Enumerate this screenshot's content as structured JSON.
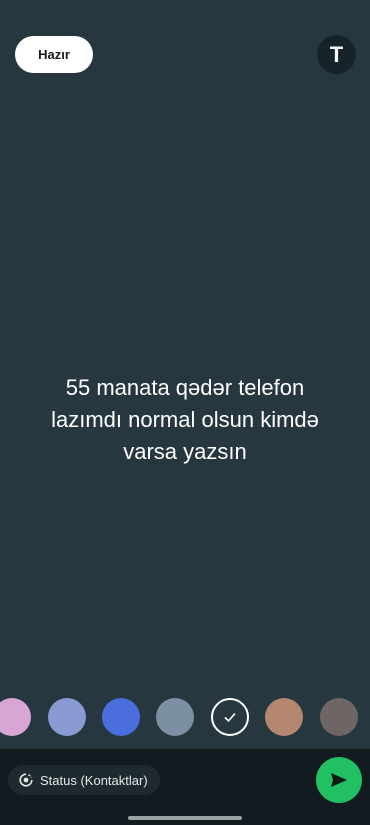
{
  "header": {
    "done_label": "Hazır",
    "text_tool_glyph": "T"
  },
  "status": {
    "text": "55 manata qədər telefon lazımdı normal olsun kimdə varsa yazsın"
  },
  "palette": {
    "colors": [
      "#d7a6d4",
      "#8a9bd4",
      "#4a6fdc",
      "#7d8fa3",
      "selected",
      "#b58670",
      "#6e6565"
    ]
  },
  "footer": {
    "audience_label": "Status (Kontaktlar)",
    "send_icon": "send-icon"
  },
  "colors": {
    "background": "#27373f",
    "accent": "#21c063"
  }
}
